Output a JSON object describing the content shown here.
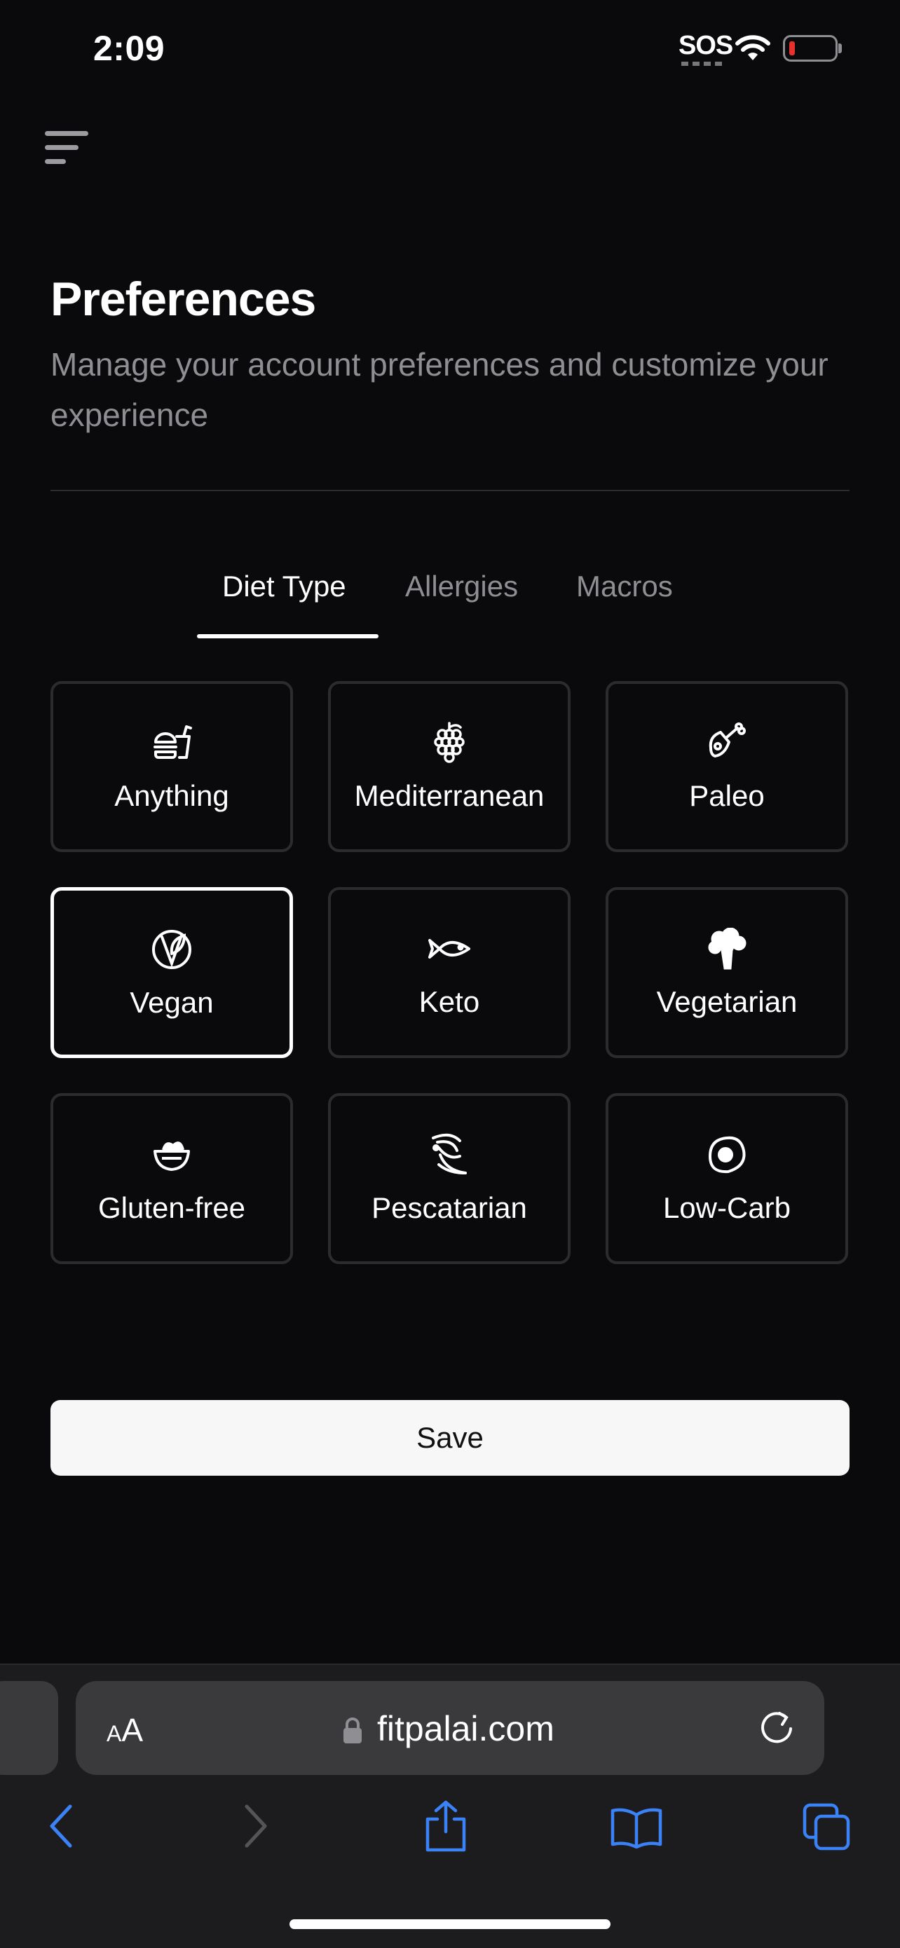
{
  "status_bar": {
    "time": "2:09",
    "sos": "SOS",
    "battery_color": "#e5322c"
  },
  "header": {
    "title": "Preferences",
    "subtitle": "Manage your account preferences and customize your experience"
  },
  "tabs": [
    {
      "label": "Diet Type",
      "active": true
    },
    {
      "label": "Allergies",
      "active": false
    },
    {
      "label": "Macros",
      "active": false
    }
  ],
  "diet_options": [
    {
      "label": "Anything",
      "icon": "burger-drink-icon"
    },
    {
      "label": "Mediterranean",
      "icon": "grapes-icon"
    },
    {
      "label": "Paleo",
      "icon": "meat-drumstick-icon"
    },
    {
      "label": "Vegan",
      "icon": "vegan-leaf-icon",
      "selected": true
    },
    {
      "label": "Keto",
      "icon": "fish-icon"
    },
    {
      "label": "Vegetarian",
      "icon": "broccoli-icon"
    },
    {
      "label": "Gluten-free",
      "icon": "salad-bowl-icon"
    },
    {
      "label": "Pescatarian",
      "icon": "shrimp-icon"
    },
    {
      "label": "Low-Carb",
      "icon": "egg-icon"
    }
  ],
  "save_label": "Save",
  "browser": {
    "text_size_small": "A",
    "text_size_large": "A",
    "url": "fitpalai.com",
    "accent_color": "#3b82f6"
  }
}
